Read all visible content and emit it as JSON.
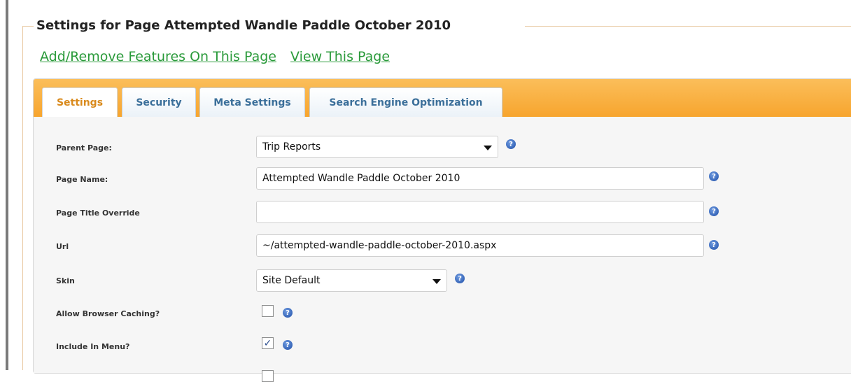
{
  "legend": "Settings for Page Attempted Wandle Paddle October 2010",
  "links": {
    "add_remove": "Add/Remove Features On This Page",
    "view_page": "View This Page"
  },
  "tabs": [
    {
      "label": "Settings",
      "active": true
    },
    {
      "label": "Security",
      "active": false
    },
    {
      "label": "Meta Settings",
      "active": false
    },
    {
      "label": "Search Engine Optimization",
      "active": false
    }
  ],
  "form": {
    "parent_page": {
      "label": "Parent Page:",
      "value": "Trip Reports"
    },
    "page_name": {
      "label": "Page Name:",
      "value": "Attempted Wandle Paddle October 2010"
    },
    "title_override": {
      "label": "Page Title Override",
      "value": ""
    },
    "url": {
      "label": "Url",
      "value": "~/attempted-wandle-paddle-october-2010.aspx"
    },
    "skin": {
      "label": "Skin",
      "value": "Site Default"
    },
    "browser_caching": {
      "label": "Allow Browser Caching?",
      "checked": false
    },
    "include_in_menu": {
      "label": "Include In Menu?",
      "checked": true
    }
  },
  "help_glyph": "?",
  "check_glyph": "✓",
  "colors": {
    "tabbar": "#f7a52e",
    "active_tab_text": "#d98a1c",
    "tab_text": "#3b6f9a",
    "link": "#2a9a3a",
    "help_icon": "#1f4fa8"
  }
}
